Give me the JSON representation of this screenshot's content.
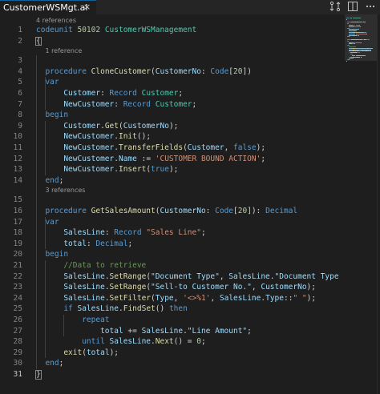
{
  "tab": {
    "title": "CustomerWSMgt.al",
    "close_glyph": "×"
  },
  "toolbar": {
    "compare_icon": "git-compare-icon",
    "split_icon": "split-editor-icon",
    "more_icon": "more-actions-icon"
  },
  "colors": {
    "keyword": "#569cd6",
    "number": "#b5cea8",
    "function": "#dcdcaa",
    "variable": "#9cdcfe",
    "type": "#4ec9b0",
    "string": "#ce9178",
    "comment": "#6a9955",
    "plain": "#d4d4d4"
  },
  "codelens": [
    {
      "before_line": 1,
      "text": "4 references",
      "indent": 0
    },
    {
      "before_line": 3,
      "text": "1 reference",
      "indent": 2
    },
    {
      "before_line": 15,
      "text": "3 references",
      "indent": 2
    }
  ],
  "lines": [
    [
      [
        "kw",
        "codeunit "
      ],
      [
        "num",
        "50102 "
      ],
      [
        "type",
        "CustomerWSManagement"
      ]
    ],
    [
      [
        "plain",
        "{"
      ]
    ],
    [],
    [
      [
        "plain",
        "  "
      ],
      [
        "kw",
        "procedure "
      ],
      [
        "fn",
        "CloneCustomer"
      ],
      [
        "plain",
        "("
      ],
      [
        "var",
        "CustomerNo"
      ],
      [
        "plain",
        ": "
      ],
      [
        "kw",
        "Code"
      ],
      [
        "plain",
        "["
      ],
      [
        "num",
        "20"
      ],
      [
        "plain",
        "])"
      ]
    ],
    [
      [
        "plain",
        "  "
      ],
      [
        "kw",
        "var"
      ]
    ],
    [
      [
        "plain",
        "      "
      ],
      [
        "var",
        "Customer"
      ],
      [
        "plain",
        ": "
      ],
      [
        "kw",
        "Record "
      ],
      [
        "type",
        "Customer"
      ],
      [
        "plain",
        ";"
      ]
    ],
    [
      [
        "plain",
        "      "
      ],
      [
        "var",
        "NewCustomer"
      ],
      [
        "plain",
        ": "
      ],
      [
        "kw",
        "Record "
      ],
      [
        "type",
        "Customer"
      ],
      [
        "plain",
        ";"
      ]
    ],
    [
      [
        "plain",
        "  "
      ],
      [
        "kw",
        "begin"
      ]
    ],
    [
      [
        "plain",
        "      "
      ],
      [
        "var",
        "Customer"
      ],
      [
        "plain",
        "."
      ],
      [
        "fn",
        "Get"
      ],
      [
        "plain",
        "("
      ],
      [
        "var",
        "CustomerNo"
      ],
      [
        "plain",
        ");"
      ]
    ],
    [
      [
        "plain",
        "      "
      ],
      [
        "var",
        "NewCustomer"
      ],
      [
        "plain",
        "."
      ],
      [
        "fn",
        "Init"
      ],
      [
        "plain",
        "();"
      ]
    ],
    [
      [
        "plain",
        "      "
      ],
      [
        "var",
        "NewCustomer"
      ],
      [
        "plain",
        "."
      ],
      [
        "fn",
        "TransferFields"
      ],
      [
        "plain",
        "("
      ],
      [
        "var",
        "Customer"
      ],
      [
        "plain",
        ", "
      ],
      [
        "kw",
        "false"
      ],
      [
        "plain",
        ");"
      ]
    ],
    [
      [
        "plain",
        "      "
      ],
      [
        "var",
        "NewCustomer"
      ],
      [
        "plain",
        "."
      ],
      [
        "var",
        "Name"
      ],
      [
        "plain",
        " := "
      ],
      [
        "str",
        "'CUSTOMER BOUND ACTION'"
      ],
      [
        "plain",
        ";"
      ]
    ],
    [
      [
        "plain",
        "      "
      ],
      [
        "var",
        "NewCustomer"
      ],
      [
        "plain",
        "."
      ],
      [
        "fn",
        "Insert"
      ],
      [
        "plain",
        "("
      ],
      [
        "kw",
        "true"
      ],
      [
        "plain",
        ");"
      ]
    ],
    [
      [
        "plain",
        "  "
      ],
      [
        "kw",
        "end"
      ],
      [
        "plain",
        ";"
      ]
    ],
    [],
    [
      [
        "plain",
        "  "
      ],
      [
        "kw",
        "procedure "
      ],
      [
        "fn",
        "GetSalesAmount"
      ],
      [
        "plain",
        "("
      ],
      [
        "var",
        "CustomerNo"
      ],
      [
        "plain",
        ": "
      ],
      [
        "kw",
        "Code"
      ],
      [
        "plain",
        "["
      ],
      [
        "num",
        "20"
      ],
      [
        "plain",
        "]): "
      ],
      [
        "kw",
        "Decimal"
      ]
    ],
    [
      [
        "plain",
        "  "
      ],
      [
        "kw",
        "var"
      ]
    ],
    [
      [
        "plain",
        "      "
      ],
      [
        "var",
        "SalesLine"
      ],
      [
        "plain",
        ": "
      ],
      [
        "kw",
        "Record "
      ],
      [
        "str",
        "\"Sales Line\""
      ],
      [
        "plain",
        ";"
      ]
    ],
    [
      [
        "plain",
        "      "
      ],
      [
        "var",
        "total"
      ],
      [
        "plain",
        ": "
      ],
      [
        "kw",
        "Decimal"
      ],
      [
        "plain",
        ";"
      ]
    ],
    [
      [
        "plain",
        "  "
      ],
      [
        "kw",
        "begin"
      ]
    ],
    [
      [
        "plain",
        "      "
      ],
      [
        "cmt",
        "//Data to retrieve"
      ]
    ],
    [
      [
        "plain",
        "      "
      ],
      [
        "var",
        "SalesLine"
      ],
      [
        "plain",
        "."
      ],
      [
        "fn",
        "SetRange"
      ],
      [
        "plain",
        "("
      ],
      [
        "var",
        "\"Document Type\""
      ],
      [
        "plain",
        ", "
      ],
      [
        "var",
        "SalesLine"
      ],
      [
        "plain",
        "."
      ],
      [
        "var",
        "\"Document Type"
      ]
    ],
    [
      [
        "plain",
        "      "
      ],
      [
        "var",
        "SalesLine"
      ],
      [
        "plain",
        "."
      ],
      [
        "fn",
        "SetRange"
      ],
      [
        "plain",
        "("
      ],
      [
        "var",
        "\"Sell-to Customer No.\""
      ],
      [
        "plain",
        ", "
      ],
      [
        "var",
        "CustomerNo"
      ],
      [
        "plain",
        ");"
      ]
    ],
    [
      [
        "plain",
        "      "
      ],
      [
        "var",
        "SalesLine"
      ],
      [
        "plain",
        "."
      ],
      [
        "fn",
        "SetFilter"
      ],
      [
        "plain",
        "("
      ],
      [
        "var",
        "Type"
      ],
      [
        "plain",
        ", "
      ],
      [
        "str",
        "'<>%1'"
      ],
      [
        "plain",
        ", "
      ],
      [
        "var",
        "SalesLine"
      ],
      [
        "plain",
        "."
      ],
      [
        "var",
        "Type"
      ],
      [
        "plain",
        "::"
      ],
      [
        "str",
        "\" \""
      ],
      [
        "plain",
        ");"
      ]
    ],
    [
      [
        "plain",
        "      "
      ],
      [
        "kw",
        "if "
      ],
      [
        "var",
        "SalesLine"
      ],
      [
        "plain",
        "."
      ],
      [
        "fn",
        "FindSet"
      ],
      [
        "plain",
        "() "
      ],
      [
        "kw",
        "then"
      ]
    ],
    [
      [
        "plain",
        "          "
      ],
      [
        "kw",
        "repeat"
      ]
    ],
    [
      [
        "plain",
        "              "
      ],
      [
        "var",
        "total"
      ],
      [
        "plain",
        " += "
      ],
      [
        "var",
        "SalesLine"
      ],
      [
        "plain",
        "."
      ],
      [
        "var",
        "\"Line Amount\""
      ],
      [
        "plain",
        ";"
      ]
    ],
    [
      [
        "plain",
        "          "
      ],
      [
        "kw",
        "until "
      ],
      [
        "var",
        "SalesLine"
      ],
      [
        "plain",
        "."
      ],
      [
        "fn",
        "Next"
      ],
      [
        "plain",
        "() = "
      ],
      [
        "num",
        "0"
      ],
      [
        "plain",
        ";"
      ]
    ],
    [
      [
        "plain",
        "      "
      ],
      [
        "fn",
        "exit"
      ],
      [
        "plain",
        "("
      ],
      [
        "var",
        "total"
      ],
      [
        "plain",
        ");"
      ]
    ],
    [
      [
        "plain",
        "  "
      ],
      [
        "kw",
        "end"
      ],
      [
        "plain",
        ";"
      ]
    ],
    [
      [
        "plain",
        "}"
      ]
    ]
  ]
}
